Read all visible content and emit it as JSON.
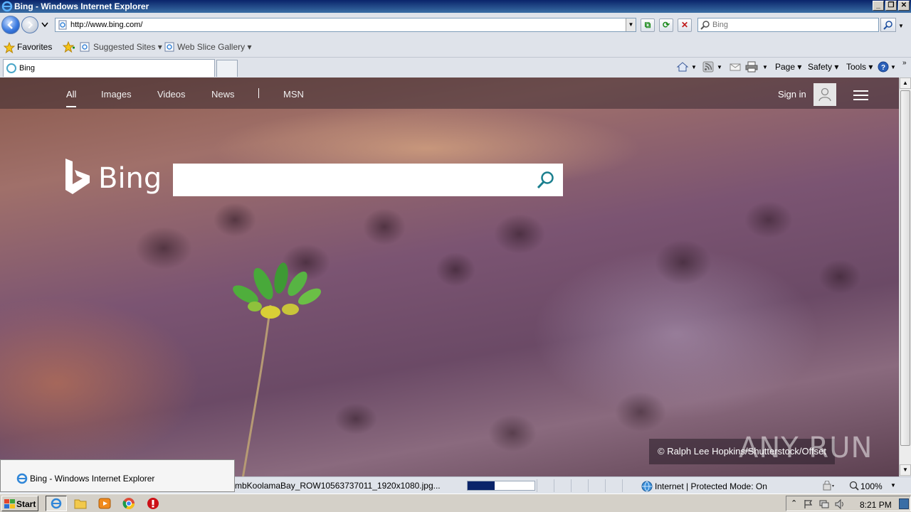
{
  "window": {
    "title": "Bing - Windows Internet Explorer"
  },
  "addressbar": {
    "url": "http://www.bing.com/",
    "search_placeholder": "Bing"
  },
  "favorites": {
    "favorites_label": "Favorites",
    "suggested_sites_label": "Suggested Sites",
    "web_slice_label": "Web Slice Gallery"
  },
  "tabs": [
    {
      "label": "Bing"
    }
  ],
  "commandbar": {
    "page_label": "Page",
    "safety_label": "Safety",
    "tools_label": "Tools"
  },
  "bing": {
    "nav": [
      "All",
      "Images",
      "Videos",
      "News",
      "MSN"
    ],
    "signin_label": "Sign in",
    "logo_text": "Bing",
    "copyright": "© Ralph Lee Hopkins/Shutterstock/Offset"
  },
  "watermark": "ANY RUN",
  "popup": {
    "label": "Bing - Windows Internet Explorer"
  },
  "statusbar": {
    "text": "mbKoolamaBay_ROW10563737011_1920x1080.jpg...",
    "progress_fraction": 0.4,
    "zone_text": "Internet | Protected Mode: On",
    "zoom_text": "100%"
  },
  "taskbar": {
    "start_label": "Start",
    "clock": "8:21 PM"
  },
  "colors": {
    "titlebar": "#0a246a",
    "accent": "#0a246a",
    "search_icon": "#1a7f8e"
  }
}
